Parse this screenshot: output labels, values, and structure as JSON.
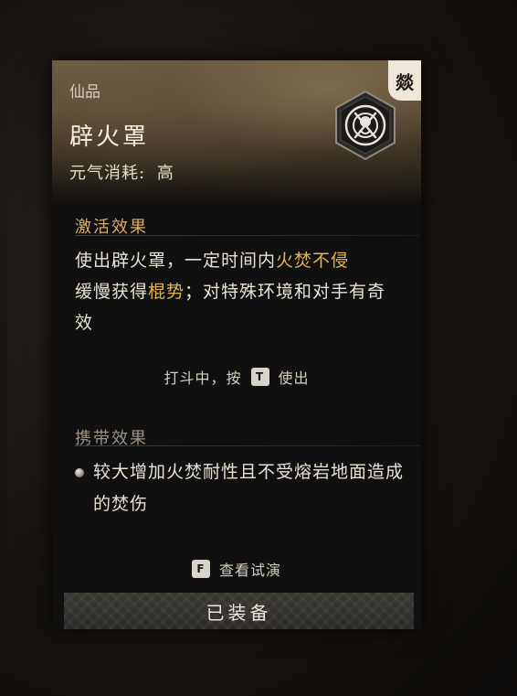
{
  "card": {
    "rarity": "仙品",
    "name": "辟火罩",
    "cost_label": "元气消耗:",
    "cost_value": "高",
    "corner_glyph": "燚",
    "emblem_icon": "flame-ward-emblem-icon"
  },
  "activation": {
    "title": "激活效果",
    "text_1": "使出辟火罩，一定时间内",
    "highlight_1": "火焚不侵",
    "text_2": "缓慢获得",
    "highlight_2": "棍势",
    "text_3": "；对特殊环境和对手有奇效",
    "hint_prefix": "打斗中，按",
    "hint_key": "T",
    "hint_suffix": "使出"
  },
  "carry": {
    "title": "携带效果",
    "text": "较大增加火焚耐性且不受熔岩地面造成的焚伤"
  },
  "preview": {
    "key": "F",
    "label": "查看试演"
  },
  "equip_button": "已装备",
  "colors": {
    "highlight": "#e3b44e",
    "section_title_active": "#d9ad62",
    "section_title_carry": "#9a9184"
  }
}
